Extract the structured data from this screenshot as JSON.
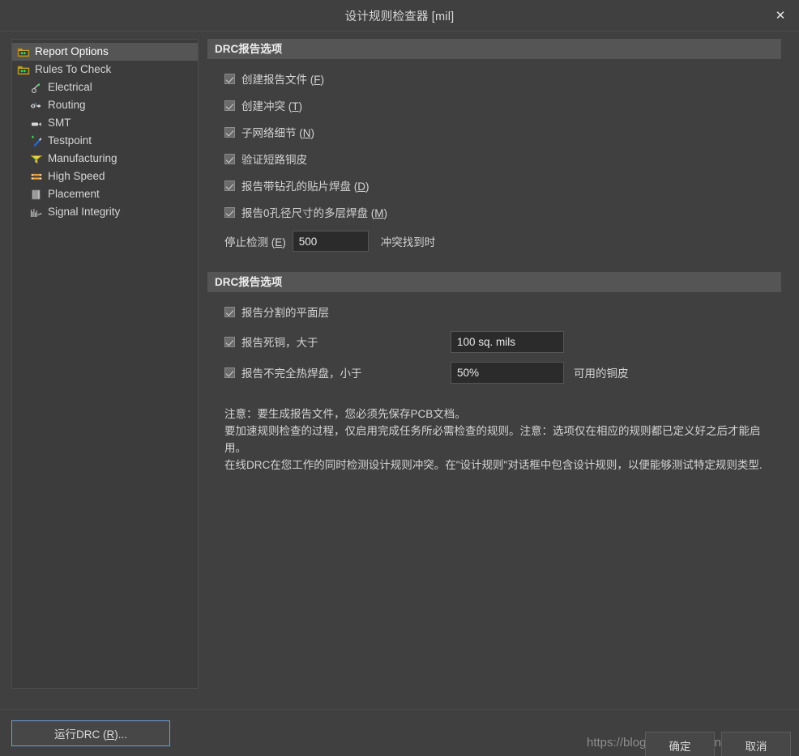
{
  "window": {
    "title": "设计规则检查器 [mil]",
    "close_label": "✕"
  },
  "sidebar": {
    "items": [
      {
        "label": "Report Options",
        "icon": "folder-arrow-icon",
        "level": 0,
        "selected": true
      },
      {
        "label": "Rules To Check",
        "icon": "folder-arrow-icon",
        "level": 0,
        "selected": false
      },
      {
        "label": "Electrical",
        "icon": "electrical-icon",
        "level": 1,
        "selected": false
      },
      {
        "label": "Routing",
        "icon": "routing-icon",
        "level": 1,
        "selected": false
      },
      {
        "label": "SMT",
        "icon": "smt-icon",
        "level": 1,
        "selected": false
      },
      {
        "label": "Testpoint",
        "icon": "testpoint-icon",
        "level": 1,
        "selected": false
      },
      {
        "label": "Manufacturing",
        "icon": "manufacturing-icon",
        "level": 1,
        "selected": false
      },
      {
        "label": "High Speed",
        "icon": "high-speed-icon",
        "level": 1,
        "selected": false
      },
      {
        "label": "Placement",
        "icon": "placement-icon",
        "level": 1,
        "selected": false
      },
      {
        "label": "Signal Integrity",
        "icon": "signal-integrity-icon",
        "level": 1,
        "selected": false
      }
    ]
  },
  "section1": {
    "header": "DRC报告选项",
    "checkboxes": [
      {
        "label": "创建报告文件 (",
        "accel": "F",
        "tail": ")",
        "checked": true
      },
      {
        "label": "创建冲突 (",
        "accel": "T",
        "tail": ")",
        "checked": true
      },
      {
        "label": "子网络细节 (",
        "accel": "N",
        "tail": ")",
        "checked": true
      },
      {
        "label": "验证短路铜皮",
        "accel": "",
        "tail": "",
        "checked": true
      },
      {
        "label": "报告带钻孔的贴片焊盘 (",
        "accel": "D",
        "tail": ")",
        "checked": true
      },
      {
        "label": "报告0孔径尺寸的多层焊盘 (",
        "accel": "M",
        "tail": ")",
        "checked": true
      }
    ],
    "stop_row": {
      "label_pre": "停止检测 (",
      "accel": "E",
      "label_post": ")",
      "value": "500",
      "suffix": "冲突找到时"
    }
  },
  "section2": {
    "header": "DRC报告选项",
    "rows": [
      {
        "label": "报告分割的平面层",
        "checked": true,
        "value": null,
        "suffix": null
      },
      {
        "label": "报告死铜，大于",
        "checked": true,
        "value": "100 sq. mils",
        "suffix": null
      },
      {
        "label": "报告不完全热焊盘，小于",
        "checked": true,
        "value": "50%",
        "suffix": "可用的铜皮"
      }
    ]
  },
  "note": {
    "lines": [
      "注意：要生成报告文件，您必须先保存PCB文档。",
      "要加速规则检查的过程，仅启用完成任务所必需检查的规则。注意：选项仅在相应的规则都已定义好之后才能启用。",
      "在线DRC在您工作的同时检测设计规则冲突。在\"设计规则\"对话框中包含设计规则，以便能够测试特定规则类型."
    ]
  },
  "footer": {
    "run_label_pre": "运行DRC (",
    "run_accel": "R",
    "run_label_post": ")...",
    "ok_label": "确定",
    "cancel_label": "取消",
    "watermark": "https://blog.csdn.net/Dandan123"
  },
  "colors": {
    "window_bg": "#404040",
    "panel_bg": "#3c3c3c",
    "section_header_bg": "#555555",
    "selection_bg": "#555555",
    "input_bg": "#2b2b2b",
    "accent_focus": "#6f9ed8",
    "text": "#d4d4d4"
  }
}
